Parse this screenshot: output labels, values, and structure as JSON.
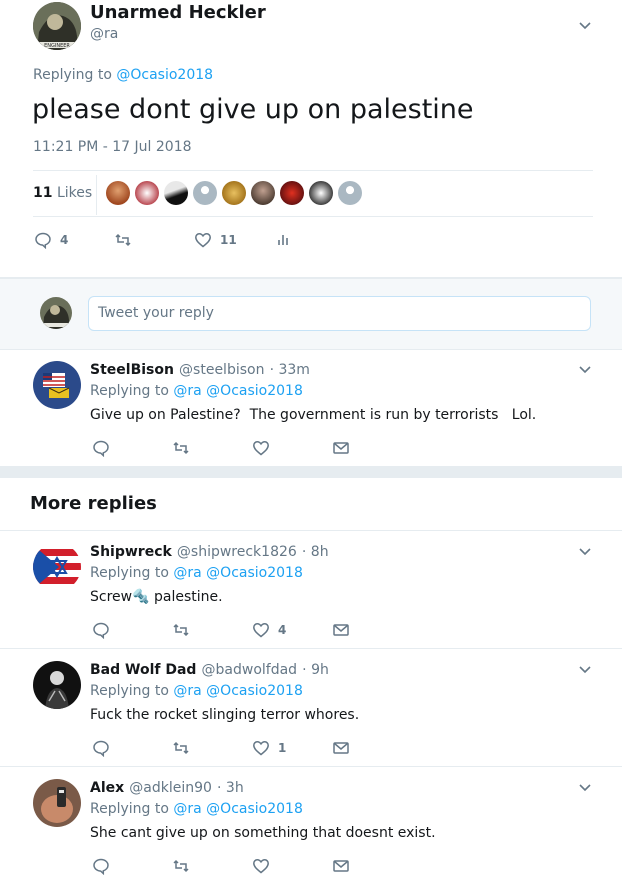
{
  "main_tweet": {
    "author_name": "Unarmed Heckler",
    "author_handle": "@ra",
    "replying_prefix": "Replying to",
    "replying_to": "@Ocasio2018",
    "text": "please dont give up on palestine",
    "timestamp": "11:21 PM - 17 Jul 2018",
    "likes_count": "11",
    "likes_label": "Likes",
    "reply_count": "4",
    "retweet_count": "",
    "like_count": "11"
  },
  "reply_box": {
    "placeholder": "Tweet your reply"
  },
  "sections": {
    "more_replies_title": "More replies"
  },
  "replies": [
    {
      "name": "SteelBison",
      "handle": "@steelbison",
      "time": "· 33m",
      "replying_prefix": "Replying to",
      "replying_to": "@ra @Ocasio2018",
      "text": "Give up on Palestine?  The government is run by terrorists   Lol.",
      "reply_count": "",
      "retweet_count": "",
      "like_count": ""
    },
    {
      "name": "Shipwreck",
      "handle": "@shipwreck1826",
      "time": "· 8h",
      "replying_prefix": "Replying to",
      "replying_to": "@ra @Ocasio2018",
      "text": "Screw🔩 palestine.",
      "reply_count": "",
      "retweet_count": "",
      "like_count": "4"
    },
    {
      "name": "Bad Wolf Dad",
      "handle": "@badwolfdad",
      "time": "· 9h",
      "replying_prefix": "Replying to",
      "replying_to": "@ra @Ocasio2018",
      "text": "Fuck the rocket slinging terror whores.",
      "reply_count": "",
      "retweet_count": "",
      "like_count": "1"
    },
    {
      "name": "Alex",
      "handle": "@adklein90",
      "time": "· 3h",
      "replying_prefix": "Replying to",
      "replying_to": "@ra @Ocasio2018",
      "text": "She cant give up on something that doesnt exist.",
      "reply_count": "",
      "retweet_count": "",
      "like_count": ""
    }
  ],
  "colors": {
    "link": "#1da1f2",
    "muted": "#657786",
    "divider": "#e6ecf0",
    "text": "#14171a"
  },
  "icons": {
    "reply": "reply-icon",
    "retweet": "retweet-icon",
    "like": "heart-icon",
    "analytics": "analytics-icon",
    "dm": "envelope-icon",
    "menu": "chevron-down-icon"
  }
}
